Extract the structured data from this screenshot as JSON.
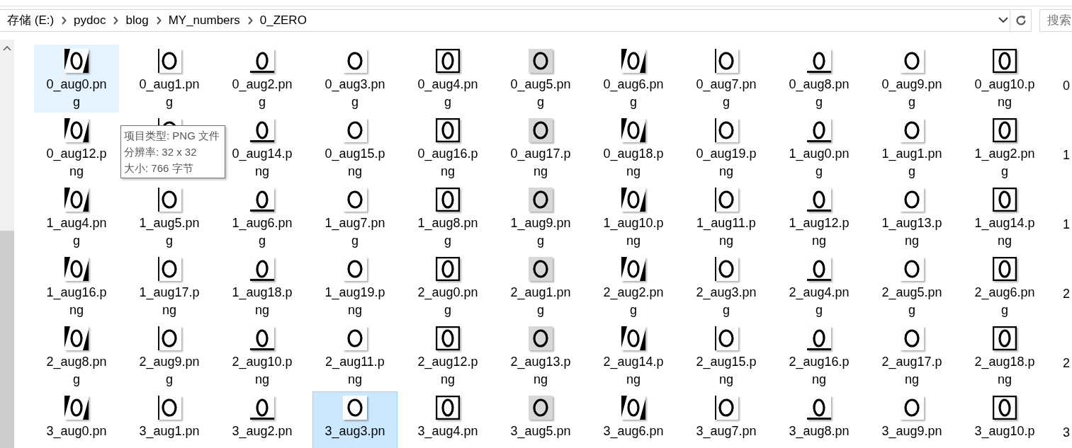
{
  "address_bar": {
    "path": [
      "存储 (E:)",
      "pydoc",
      "blog",
      "MY_numbers",
      "0_ZERO"
    ]
  },
  "search": {
    "placeholder": "搜索"
  },
  "files": [
    {
      "label": "0_aug0.png",
      "kind": "full",
      "selected": false,
      "hovered": true
    },
    {
      "label": "0_aug1.png",
      "kind": "full",
      "selected": false,
      "hovered": false
    },
    {
      "label": "0_aug2.png",
      "kind": "full",
      "selected": false,
      "hovered": false
    },
    {
      "label": "0_aug3.png",
      "kind": "full",
      "selected": false,
      "hovered": false
    },
    {
      "label": "0_aug4.png",
      "kind": "full",
      "selected": false,
      "hovered": false
    },
    {
      "label": "0_aug5.png",
      "kind": "full",
      "selected": false,
      "hovered": false
    },
    {
      "label": "0_aug6.png",
      "kind": "full",
      "selected": false,
      "hovered": false
    },
    {
      "label": "0_aug7.png",
      "kind": "full",
      "selected": false,
      "hovered": false
    },
    {
      "label": "0_aug8.png",
      "kind": "full",
      "selected": false,
      "hovered": false
    },
    {
      "label": "0_aug9.png",
      "kind": "full",
      "selected": false,
      "hovered": false
    },
    {
      "label": "0_aug10.png",
      "kind": "full",
      "selected": false,
      "hovered": false
    },
    {
      "label": "0",
      "kind": "cut",
      "selected": false,
      "hovered": false
    },
    {
      "label": "0_aug12.png",
      "kind": "full",
      "selected": false,
      "hovered": false
    },
    {
      "kind": "covered",
      "selected": false,
      "hovered": false
    },
    {
      "label": "0_aug14.png",
      "kind": "full",
      "selected": false,
      "hovered": false
    },
    {
      "label": "0_aug15.png",
      "kind": "full",
      "selected": false,
      "hovered": false
    },
    {
      "label": "0_aug16.png",
      "kind": "full",
      "selected": false,
      "hovered": false
    },
    {
      "label": "0_aug17.png",
      "kind": "full",
      "selected": false,
      "hovered": false
    },
    {
      "label": "0_aug18.png",
      "kind": "full",
      "selected": false,
      "hovered": false
    },
    {
      "label": "0_aug19.png",
      "kind": "full",
      "selected": false,
      "hovered": false
    },
    {
      "label": "1_aug0.png",
      "kind": "full",
      "selected": false,
      "hovered": false
    },
    {
      "label": "1_aug1.png",
      "kind": "full",
      "selected": false,
      "hovered": false
    },
    {
      "label": "1_aug2.png",
      "kind": "full",
      "selected": false,
      "hovered": false
    },
    {
      "label": "1",
      "kind": "cut",
      "selected": false,
      "hovered": false
    },
    {
      "label": "1_aug4.png",
      "kind": "full",
      "selected": false,
      "hovered": false
    },
    {
      "label": "1_aug5.png",
      "kind": "full",
      "selected": false,
      "hovered": false
    },
    {
      "label": "1_aug6.png",
      "kind": "full",
      "selected": false,
      "hovered": false
    },
    {
      "label": "1_aug7.png",
      "kind": "full",
      "selected": false,
      "hovered": false
    },
    {
      "label": "1_aug8.png",
      "kind": "full",
      "selected": false,
      "hovered": false
    },
    {
      "label": "1_aug9.png",
      "kind": "full",
      "selected": false,
      "hovered": false
    },
    {
      "label": "1_aug10.png",
      "kind": "full",
      "selected": false,
      "hovered": false
    },
    {
      "label": "1_aug11.png",
      "kind": "full",
      "selected": false,
      "hovered": false
    },
    {
      "label": "1_aug12.png",
      "kind": "full",
      "selected": false,
      "hovered": false
    },
    {
      "label": "1_aug13.png",
      "kind": "full",
      "selected": false,
      "hovered": false
    },
    {
      "label": "1_aug14.png",
      "kind": "full",
      "selected": false,
      "hovered": false
    },
    {
      "label": "1",
      "kind": "cut",
      "selected": false,
      "hovered": false
    },
    {
      "label": "1_aug16.png",
      "kind": "full",
      "selected": false,
      "hovered": false
    },
    {
      "label": "1_aug17.png",
      "kind": "full",
      "selected": false,
      "hovered": false
    },
    {
      "label": "1_aug18.png",
      "kind": "full",
      "selected": false,
      "hovered": false
    },
    {
      "label": "1_aug19.png",
      "kind": "full",
      "selected": false,
      "hovered": false
    },
    {
      "label": "2_aug0.png",
      "kind": "full",
      "selected": false,
      "hovered": false
    },
    {
      "label": "2_aug1.png",
      "kind": "full",
      "selected": false,
      "hovered": false
    },
    {
      "label": "2_aug2.png",
      "kind": "full",
      "selected": false,
      "hovered": false
    },
    {
      "label": "2_aug3.png",
      "kind": "full",
      "selected": false,
      "hovered": false
    },
    {
      "label": "2_aug4.png",
      "kind": "full",
      "selected": false,
      "hovered": false
    },
    {
      "label": "2_aug5.png",
      "kind": "full",
      "selected": false,
      "hovered": false
    },
    {
      "label": "2_aug6.png",
      "kind": "full",
      "selected": false,
      "hovered": false
    },
    {
      "label": "2",
      "kind": "cut",
      "selected": false,
      "hovered": false
    },
    {
      "label": "2_aug8.png",
      "kind": "full",
      "selected": false,
      "hovered": false
    },
    {
      "label": "2_aug9.png",
      "kind": "full",
      "selected": false,
      "hovered": false
    },
    {
      "label": "2_aug10.png",
      "kind": "full",
      "selected": false,
      "hovered": false
    },
    {
      "label": "2_aug11.png",
      "kind": "full",
      "selected": false,
      "hovered": false
    },
    {
      "label": "2_aug12.png",
      "kind": "full",
      "selected": false,
      "hovered": false
    },
    {
      "label": "2_aug13.png",
      "kind": "full",
      "selected": false,
      "hovered": false
    },
    {
      "label": "2_aug14.png",
      "kind": "full",
      "selected": false,
      "hovered": false
    },
    {
      "label": "2_aug15.png",
      "kind": "full",
      "selected": false,
      "hovered": false
    },
    {
      "label": "2_aug16.png",
      "kind": "full",
      "selected": false,
      "hovered": false
    },
    {
      "label": "2_aug17.png",
      "kind": "full",
      "selected": false,
      "hovered": false
    },
    {
      "label": "2_aug18.png",
      "kind": "full",
      "selected": false,
      "hovered": false
    },
    {
      "label": "2",
      "kind": "cut",
      "selected": false,
      "hovered": false
    },
    {
      "label": "3_aug0.pn",
      "kind": "full",
      "selected": false,
      "hovered": false
    },
    {
      "label": "3_aug1.pn",
      "kind": "full",
      "selected": false,
      "hovered": false
    },
    {
      "label": "3_aug2.pn",
      "kind": "full",
      "selected": false,
      "hovered": false
    },
    {
      "label": "3_aug3.pn",
      "kind": "full",
      "selected": true,
      "hovered": false
    },
    {
      "label": "3_aug4.pn",
      "kind": "full",
      "selected": false,
      "hovered": false
    },
    {
      "label": "3_aug5.pn",
      "kind": "full",
      "selected": false,
      "hovered": false
    },
    {
      "label": "3_aug6.pn",
      "kind": "full",
      "selected": false,
      "hovered": false
    },
    {
      "label": "3_aug7.pn",
      "kind": "full",
      "selected": false,
      "hovered": false
    },
    {
      "label": "3_aug8.pn",
      "kind": "full",
      "selected": false,
      "hovered": false
    },
    {
      "label": "3_aug9.pn",
      "kind": "full",
      "selected": false,
      "hovered": false
    },
    {
      "label": "3_aug10.p",
      "kind": "full",
      "selected": false,
      "hovered": false
    },
    {
      "label": "3",
      "kind": "cut",
      "selected": false,
      "hovered": false
    }
  ],
  "tooltip": {
    "lines": [
      "项目类型: PNG 文件",
      "分辨率: 32 x 32",
      "大小: 766 字节"
    ]
  }
}
